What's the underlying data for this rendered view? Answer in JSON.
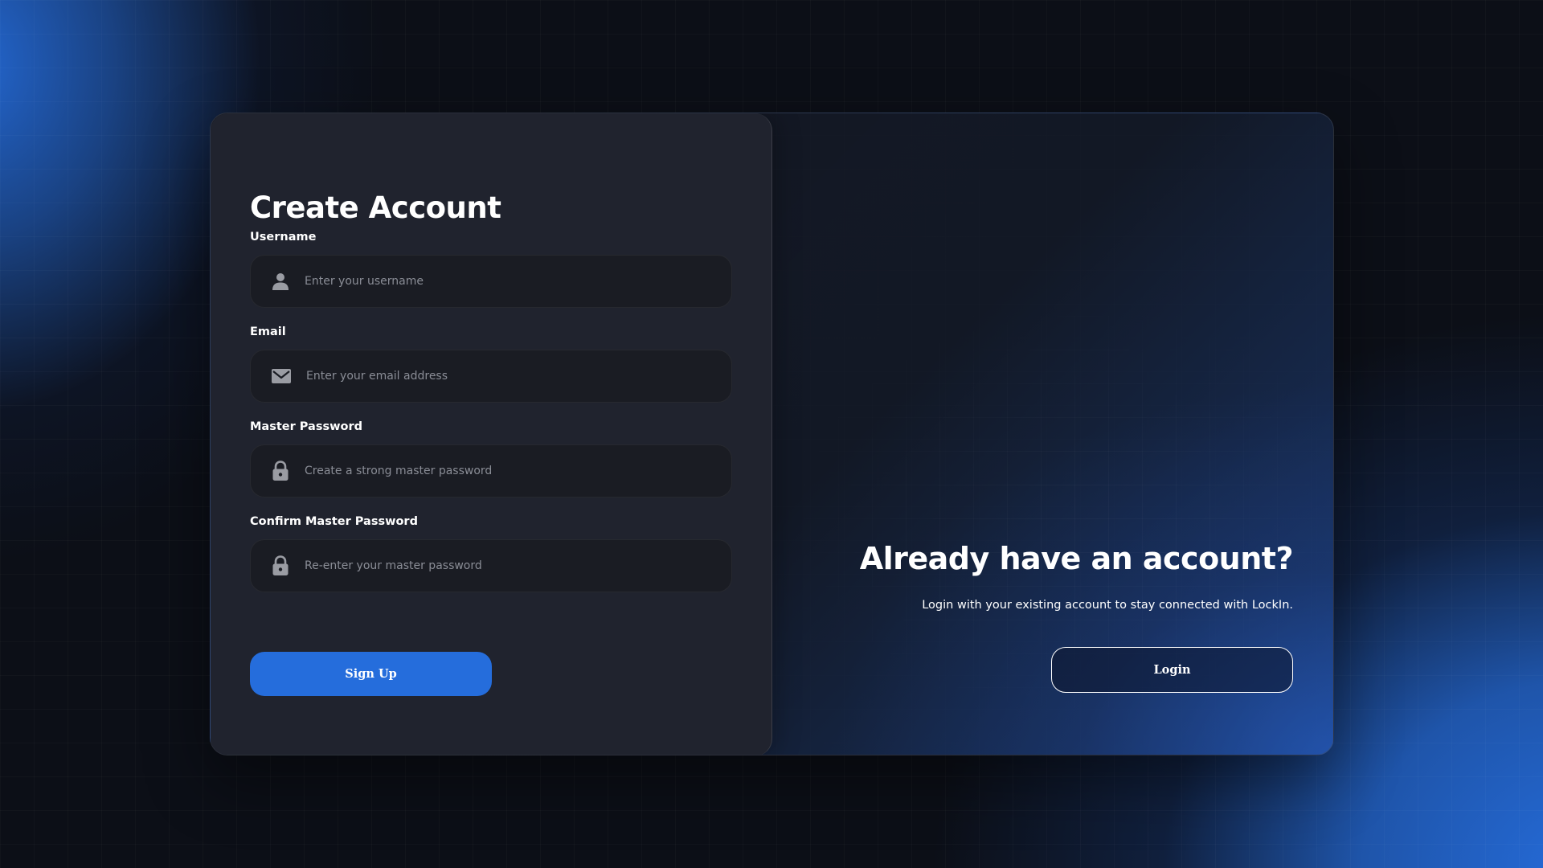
{
  "colors": {
    "accent": "#256ddc",
    "background": "#0c0f17",
    "panel": "#20232e",
    "input_bg": "#1a1c23",
    "placeholder": "#8a8d96",
    "icon": "#9a9ca3"
  },
  "signup_form": {
    "title": "Create Account",
    "fields": [
      {
        "label": "Username",
        "placeholder": "Enter your username",
        "icon": "user-icon"
      },
      {
        "label": "Email",
        "placeholder": "Enter your email address",
        "icon": "mail-icon"
      },
      {
        "label": "Master Password",
        "placeholder": "Create a strong master password",
        "icon": "lock-icon"
      },
      {
        "label": "Confirm Master Password",
        "placeholder": "Re-enter your master password",
        "icon": "lock-icon"
      }
    ],
    "submit_label": "Sign Up"
  },
  "login_prompt": {
    "title": "Already have an account?",
    "subtitle": "Login with your existing account to stay connected with LockIn.",
    "button_label": "Login"
  }
}
